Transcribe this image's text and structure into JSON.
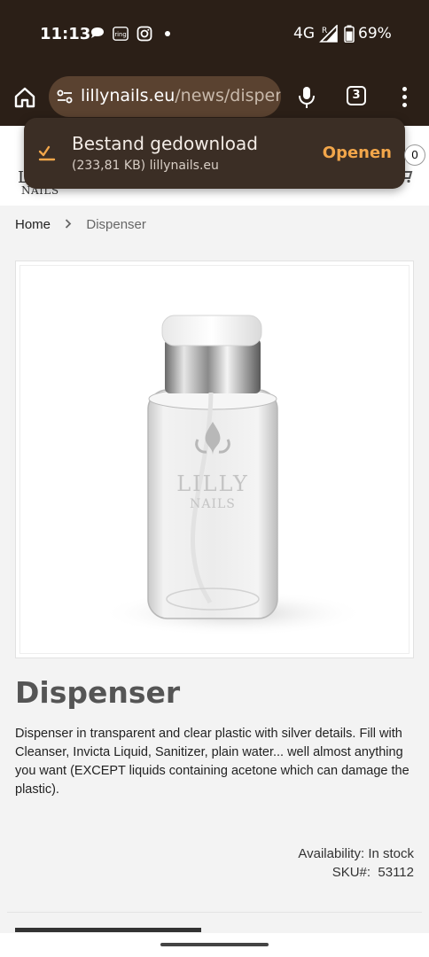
{
  "status_bar": {
    "time": "11:13",
    "notification_icons": [
      "chat-bubble-icon",
      "ring-icon",
      "instagram-icon",
      "more-dot-icon"
    ],
    "ring_label": "ring",
    "network": "4G",
    "roaming": "R",
    "battery_percent": "69%"
  },
  "browser": {
    "url_domain": "lillynails.eu",
    "url_path": "/news/disper",
    "tab_count": "3"
  },
  "download_toast": {
    "title": "Bestand gedownload",
    "subtitle": "(233,81 KB) lillynails.eu",
    "action": "Openen"
  },
  "site": {
    "logo_top": "L",
    "logo_bottom": "NAILS",
    "cart_count": "0"
  },
  "breadcrumb": {
    "home": "Home",
    "current": "Dispenser"
  },
  "product": {
    "title": "Dispenser",
    "description": "Dispenser in transparent and clear plastic with silver details. Fill with Cleanser, Invicta Liquid, Sanitizer, plain water... well almost anything you want (EXCEPT liquids containing acetone which can damage the plastic).",
    "availability_label": "Availability:",
    "availability_value": "In stock",
    "sku_label": "SKU#:",
    "sku_value": "53112",
    "image_brand_top": "LILLY",
    "image_brand_bottom": "NAILS"
  },
  "colors": {
    "chrome_bg": "#2b1f17",
    "urlbar_bg": "#5a4230",
    "toast_bg": "#3b2e25",
    "toast_action": "#f2a64a",
    "check_accent": "#f2a64a"
  }
}
